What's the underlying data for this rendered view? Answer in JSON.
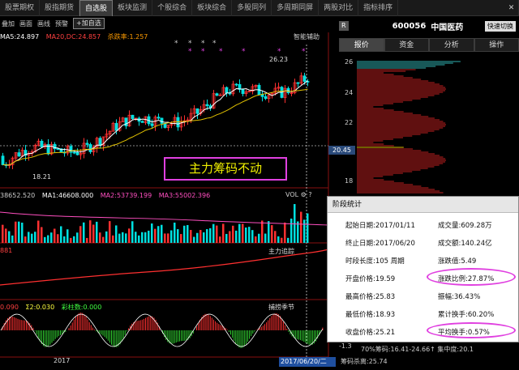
{
  "tabs": [
    "股票期权",
    "股指期货",
    "自选股",
    "板块监测",
    "个股综合",
    "板块综合",
    "多股同列",
    "多周期同屏",
    "两股对比",
    "指标排序"
  ],
  "active_tab": "自选股",
  "close_glyph": "✕",
  "toolbar": {
    "add_label": "叠加",
    "draw_label": "画面",
    "curve_label": "画线",
    "warn_label": "预警",
    "add_self_label": "+加自选"
  },
  "info": {
    "ma5": "MA5:24.897",
    "ma20": "MA20,DC:24.857",
    "rate": "杀跌率:1.257"
  },
  "smart_label": "智能辅助",
  "annotation_text": "主力筹码不动",
  "price_labels": {
    "high": "26.23",
    "low": "18.21"
  },
  "vol": {
    "total": "38652.520",
    "ma1": "MA1:46608.000",
    "ma2": "MA2:53739.199",
    "ma3": "MA3:55002.396",
    "label": "VOL"
  },
  "main_track": {
    "value": "881",
    "label": "主力追踪"
  },
  "season": {
    "v1": "0.090",
    "v2": "Σ2:0.030",
    "v3": "彩柱数:0.000",
    "label": "捕捞季节"
  },
  "year": "2017",
  "time_cursor": "2017/06/20/二",
  "line_glyph": "线",
  "side": {
    "badge": "R",
    "code": "600056",
    "name": "中国医药",
    "switch": "快速切换",
    "tabs": [
      "报价",
      "资金",
      "分析",
      "操作"
    ],
    "active_tab": "报价"
  },
  "y_axis": [
    "26",
    "24",
    "22",
    "20",
    "18"
  ],
  "current_price": "20.45",
  "stat": {
    "title": "阶段统计",
    "start_date": "起始日期:2017/01/11",
    "end_date": "终止日期:2017/06/20",
    "duration": "时段长度:105 周期",
    "open_price": "开盘价格:19.59",
    "high_price": "最高价格:25.83",
    "low_price": "最低价格:18.93",
    "close_price": "收盘价格:25.21",
    "volume": "成交量:609.28万",
    "amount": "成交额:140.24亿",
    "change_value": "涨跌值:5.49",
    "change_pct": "涨跌比例:27.87%",
    "amplitude": "振幅:36.43%",
    "cum_turnover": "累计换手:60.20%",
    "avg_turnover": "平均换手:0.57%"
  },
  "bottom": {
    "minus": "-1.3",
    "chip_line": "70%筹码:16.41-24.66↑ 集中度:20.1",
    "cost_line": "筹码杀离:25.74"
  },
  "colors": {
    "up": "#ff3030",
    "down": "#00e0e0",
    "ma_white": "#ffffff",
    "ma_yellow": "#e0c000",
    "highlight": "#e040e0"
  }
}
